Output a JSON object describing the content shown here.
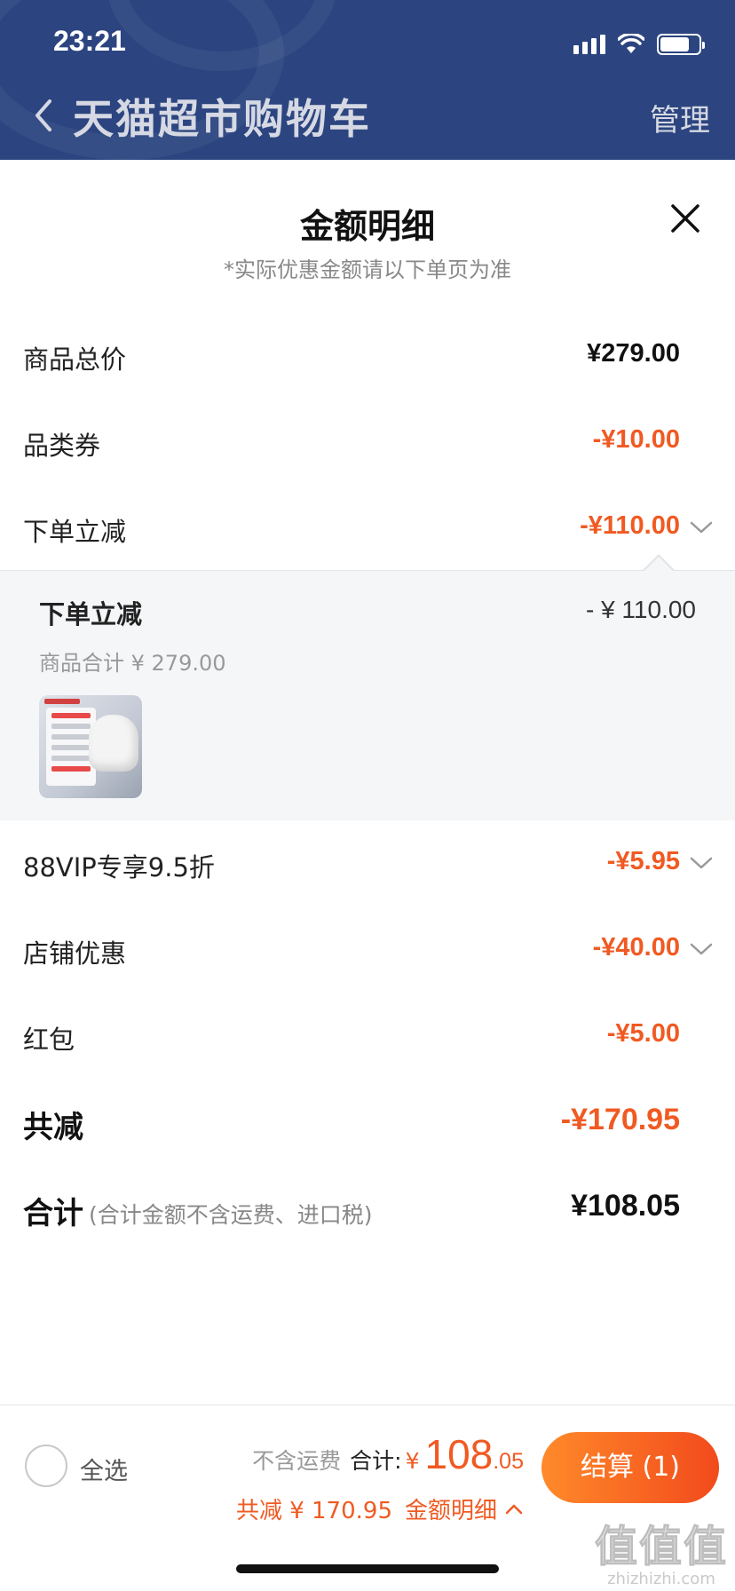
{
  "status": {
    "time": "23:21"
  },
  "nav": {
    "title": "天猫超市购物车",
    "manage": "管理"
  },
  "sheet": {
    "title": "金额明细",
    "subtitle": "*实际优惠金额请以下单页为准"
  },
  "rows": {
    "total_price": {
      "label": "商品总价",
      "amount": "¥279.00"
    },
    "category_coupon": {
      "label": "品类券",
      "amount": "-¥10.00"
    },
    "order_discount": {
      "label": "下单立减",
      "amount": "-¥110.00"
    },
    "vip": {
      "label": "88VIP专享9.5折",
      "amount": "-¥5.95"
    },
    "store": {
      "label": "店铺优惠",
      "amount": "-¥40.00"
    },
    "red_packet": {
      "label": "红包",
      "amount": "-¥5.00"
    },
    "total_saved": {
      "label": "共减",
      "amount": "-¥170.95"
    },
    "grand_total": {
      "label": "合计",
      "note": "(合计金额不含运费、进口税)",
      "amount": "¥108.05"
    }
  },
  "expanded": {
    "title": "下单立减",
    "amount": "- ¥ 110.00",
    "subtotal": "商品合计 ¥ 279.00"
  },
  "bottom": {
    "select_all": "全选",
    "no_shipping": "不含运费",
    "total_label": "合计:",
    "yen": "¥",
    "total_int": "108",
    "total_dec": ".05",
    "saved": "共减 ¥ 170.95",
    "detail": "金额明细",
    "checkout": "结算 (1)"
  },
  "watermark": {
    "big": "值值值",
    "small": "zhizhizhi.com"
  },
  "colors": {
    "header": "#2c4580",
    "accent": "#f05a22"
  },
  "icons": [
    "back-chevron-icon",
    "close-icon",
    "chevron-down-icon",
    "chevron-up-icon",
    "signal-icon",
    "wifi-icon",
    "battery-icon"
  ]
}
